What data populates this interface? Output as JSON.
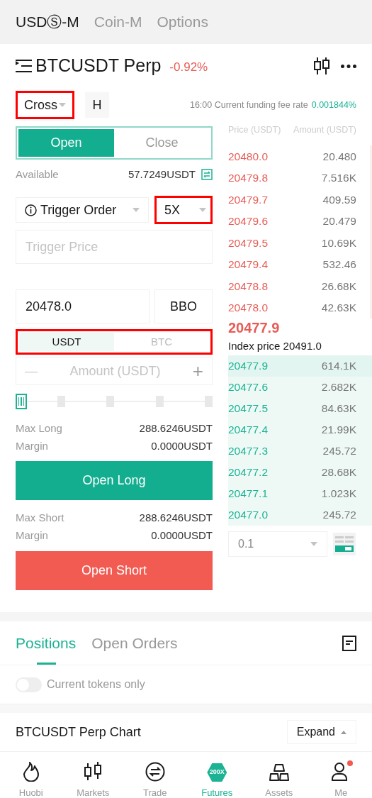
{
  "market_tabs": [
    {
      "label": "USDⓈ-M",
      "selected": true
    },
    {
      "label": "Coin-M",
      "selected": false
    },
    {
      "label": "Options",
      "selected": false
    }
  ],
  "header": {
    "symbol": "BTCUSDT Perp",
    "change": "-0.92%"
  },
  "margin_mode": {
    "value": "Cross",
    "highlighted": true
  },
  "position_mode": "H",
  "funding": {
    "label": "16:00 Current funding fee rate",
    "rate": "0.001844%"
  },
  "side_tabs": [
    {
      "label": "Open",
      "selected": true
    },
    {
      "label": "Close",
      "selected": false
    }
  ],
  "available": {
    "label": "Available",
    "value": "57.7249USDT"
  },
  "order_type": {
    "value": "Trigger Order"
  },
  "leverage": {
    "value": "5X",
    "highlighted": true
  },
  "trigger_price": {
    "placeholder": "Trigger Price"
  },
  "price": {
    "value": "20478.0",
    "bbo": "BBO"
  },
  "unit_toggle": {
    "highlighted": true,
    "options": [
      {
        "label": "USDT",
        "selected": true
      },
      {
        "label": "BTC",
        "selected": false
      }
    ]
  },
  "amount": {
    "placeholder": "Amount (USDT)",
    "minus": "—",
    "plus": "+"
  },
  "long": {
    "rows": [
      {
        "label": "Max Long",
        "value": "288.6246USDT"
      },
      {
        "label": "Margin",
        "value": "0.0000USDT"
      }
    ],
    "button": "Open Long"
  },
  "short": {
    "rows": [
      {
        "label": "Max Short",
        "value": "288.6246USDT"
      },
      {
        "label": "Margin",
        "value": "0.0000USDT"
      }
    ],
    "button": "Open Short"
  },
  "order_book": {
    "columns": [
      "Price (USDT)",
      "Amount (USDT)"
    ],
    "asks": [
      {
        "price": "20480.0",
        "amount": "20.480"
      },
      {
        "price": "20479.8",
        "amount": "7.516K"
      },
      {
        "price": "20479.7",
        "amount": "409.59"
      },
      {
        "price": "20479.6",
        "amount": "20.479"
      },
      {
        "price": "20479.5",
        "amount": "10.69K"
      },
      {
        "price": "20479.4",
        "amount": "532.46"
      },
      {
        "price": "20478.8",
        "amount": "26.68K"
      },
      {
        "price": "20478.0",
        "amount": "42.63K"
      }
    ],
    "last_price": "20477.9",
    "index_price": "Index price 20491.0",
    "bids": [
      {
        "price": "20477.9",
        "amount": "614.1K"
      },
      {
        "price": "20477.6",
        "amount": "2.682K"
      },
      {
        "price": "20477.5",
        "amount": "84.63K"
      },
      {
        "price": "20477.4",
        "amount": "21.99K"
      },
      {
        "price": "20477.3",
        "amount": "245.72"
      },
      {
        "price": "20477.2",
        "amount": "28.68K"
      },
      {
        "price": "20477.1",
        "amount": "1.023K"
      },
      {
        "price": "20477.0",
        "amount": "245.72"
      }
    ],
    "precision": "0.1"
  },
  "bottom_tabs": [
    {
      "label": "Positions",
      "selected": true
    },
    {
      "label": "Open Orders",
      "selected": false
    }
  ],
  "filter": {
    "label": "Current tokens only",
    "on": false
  },
  "chart_bar": {
    "title": "BTCUSDT Perp Chart",
    "button": "Expand"
  },
  "nav": [
    {
      "kind": "flame",
      "label": "Huobi",
      "selected": false,
      "dot": false
    },
    {
      "kind": "candles",
      "label": "Markets",
      "selected": false,
      "dot": false
    },
    {
      "kind": "swap",
      "label": "Trade",
      "selected": false,
      "dot": false
    },
    {
      "kind": "hexagon",
      "label": "Futures",
      "badge": "200X",
      "selected": true,
      "dot": false
    },
    {
      "kind": "bars",
      "label": "Assets",
      "selected": false,
      "dot": false
    },
    {
      "kind": "person",
      "label": "Me",
      "selected": false,
      "dot": true
    }
  ]
}
